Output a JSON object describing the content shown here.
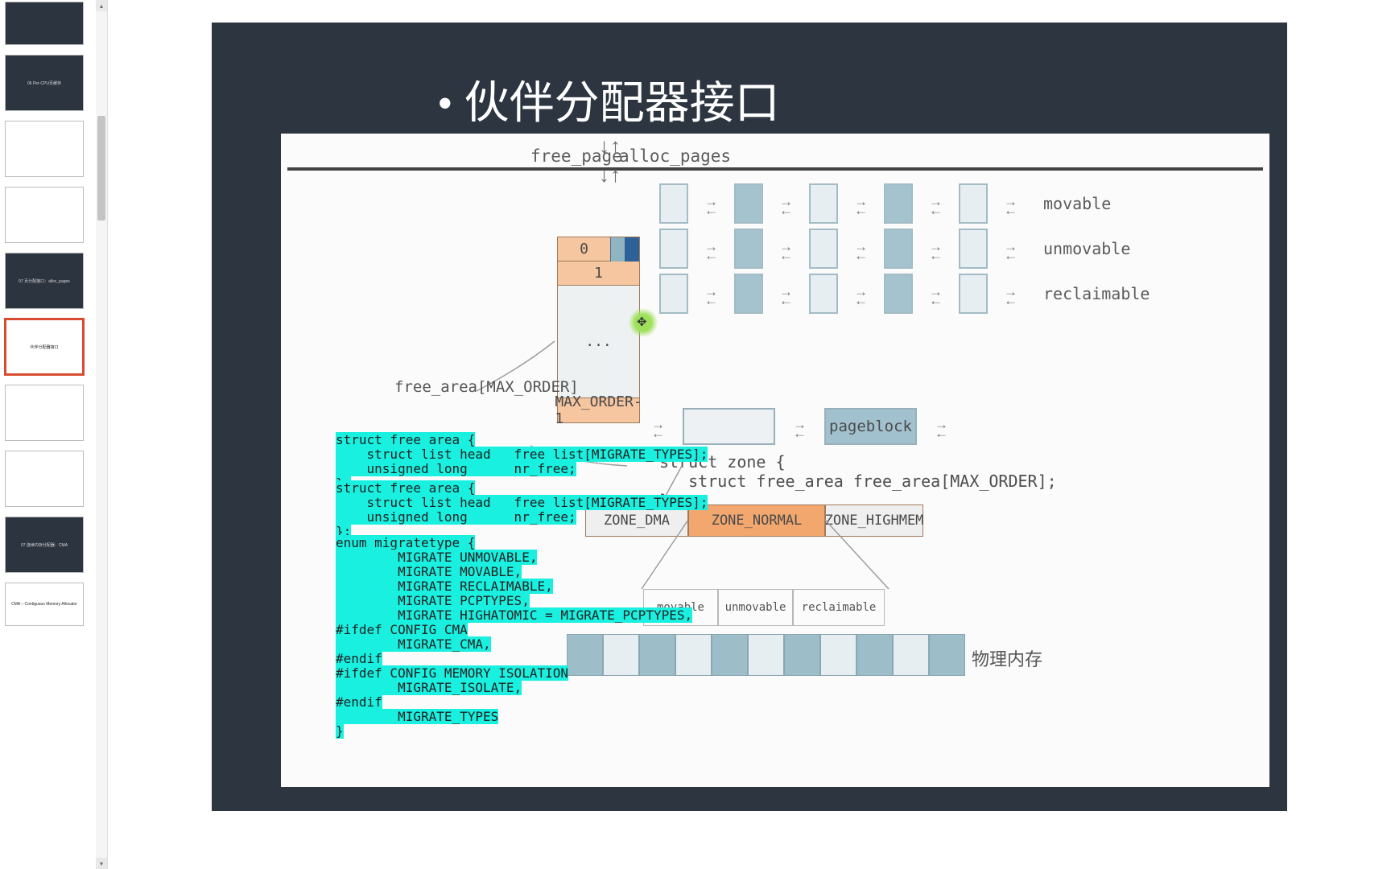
{
  "thumbs": [
    {
      "label": "",
      "dark": true
    },
    {
      "label": "06 Per-CPU页缓存",
      "dark": true
    },
    {
      "label": "",
      "dark": false
    },
    {
      "label": "",
      "dark": false
    },
    {
      "label": "07 页分配接口：alloc_pages",
      "dark": true
    },
    {
      "label": "伙伴分配器接口",
      "dark": false,
      "selected": true
    },
    {
      "label": "",
      "dark": false
    },
    {
      "label": "",
      "dark": false
    },
    {
      "label": "07 连续内存分配器：CMA",
      "dark": true
    },
    {
      "label": "CMA – Contiguous Memory Allocator",
      "dark": false
    }
  ],
  "title": "伙伴分配器接口",
  "api": {
    "left": "free_page",
    "right": "alloc_pages"
  },
  "order_cells": [
    "0",
    "1",
    "...",
    "MAX_ORDER-1"
  ],
  "mig_rows": [
    {
      "label": "movable"
    },
    {
      "label": "unmovable"
    },
    {
      "label": "reclaimable"
    }
  ],
  "pageblock": "pageblock",
  "zone_code": "struct zone {\n   struct free_area free_area[MAX_ORDER];\n}",
  "zones": [
    "ZONE_DMA",
    "ZONE_NORMAL",
    "ZONE_HIGHMEM"
  ],
  "sub_types": [
    "movable",
    "unmovable",
    "reclaimable"
  ],
  "phys_label": "物理内存",
  "free_area_label": "free_area[MAX_ORDER]",
  "code1": "struct free_area {\n    struct list_head   free_list[MIGRATE_TYPES];\n    unsigned long      nr_free;\n};",
  "code2": "struct free_area {\n    struct list_head   free_list[MIGRATE_TYPES];\n    unsigned long      nr_free;\n};",
  "code3": "enum migratetype {\n        MIGRATE_UNMOVABLE,\n        MIGRATE_MOVABLE,\n        MIGRATE_RECLAIMABLE,\n        MIGRATE_PCPTYPES,\n        MIGRATE_HIGHATOMIC = MIGRATE_PCPTYPES,\n#ifdef CONFIG_CMA\n        MIGRATE_CMA,\n#endif\n#ifdef CONFIG_MEMORY_ISOLATION\n        MIGRATE_ISOLATE,\n#endif\n        MIGRATE_TYPES\n}"
}
